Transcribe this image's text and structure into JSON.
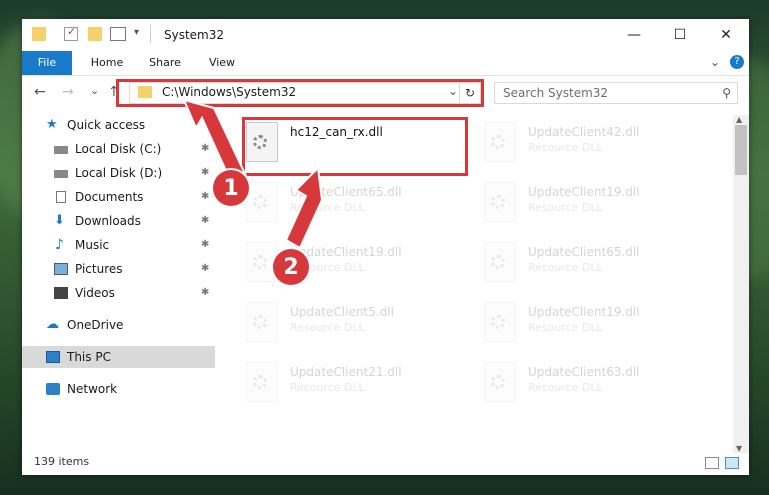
{
  "window": {
    "title": "System32",
    "minimize_glyph": "—",
    "maximize_glyph": "☐",
    "close_glyph": "✕"
  },
  "ribbon": {
    "tabs": [
      "File",
      "Home",
      "Share",
      "View"
    ],
    "expand_glyph": "⌄",
    "help_glyph": "?"
  },
  "address": {
    "path": "C:\\Windows\\System32",
    "dropdown_glyph": "⌄",
    "refresh_glyph": "↻"
  },
  "search": {
    "placeholder": "Search System32",
    "icon": "search-icon"
  },
  "nav": {
    "back_glyph": "←",
    "forward_glyph": "→",
    "recent_glyph": "⌄",
    "up_glyph": "↑",
    "items": [
      {
        "label": "Quick access",
        "icon": "star-icon",
        "pinned": false
      },
      {
        "label": "Local Disk (C:)",
        "icon": "drive-icon",
        "pinned": true
      },
      {
        "label": "Local Disk (D:)",
        "icon": "drive-icon",
        "pinned": true
      },
      {
        "label": "Documents",
        "icon": "document-icon",
        "pinned": true
      },
      {
        "label": "Downloads",
        "icon": "download-icon",
        "pinned": true
      },
      {
        "label": "Music",
        "icon": "music-icon",
        "pinned": true
      },
      {
        "label": "Pictures",
        "icon": "pictures-icon",
        "pinned": true
      },
      {
        "label": "Videos",
        "icon": "video-icon",
        "pinned": true
      },
      {
        "label": "OneDrive",
        "icon": "cloud-icon",
        "pinned": false
      },
      {
        "label": "This PC",
        "icon": "computer-icon",
        "pinned": false
      },
      {
        "label": "Network",
        "icon": "network-icon",
        "pinned": false
      }
    ],
    "pin_glyph": "📌"
  },
  "files": [
    {
      "name": "hc12_can_rx.dll",
      "type": ""
    },
    {
      "name": "UpdateClient42.dll",
      "type": "Resource DLL"
    },
    {
      "name": "UpdateClient65.dll",
      "type": "Resource DLL"
    },
    {
      "name": "UpdateClient19.dll",
      "type": "Resource DLL"
    },
    {
      "name": "UpdateClient19.dll",
      "type": "Resource DLL"
    },
    {
      "name": "UpdateClient65.dll",
      "type": "Resource DLL"
    },
    {
      "name": "UpdateClient5.dll",
      "type": "Resource DLL"
    },
    {
      "name": "UpdateClient19.dll",
      "type": "Resource DLL"
    },
    {
      "name": "UpdateClient21.dll",
      "type": "Resource DLL"
    },
    {
      "name": "UpdateClient63.dll",
      "type": "Resource DLL"
    }
  ],
  "status": {
    "item_count": "139 items"
  },
  "callouts": {
    "step1": "1",
    "step2": "2"
  },
  "colors": {
    "accent": "#1979ca",
    "highlight": "#d7383c",
    "selected_nav": "#d9d9d9"
  }
}
